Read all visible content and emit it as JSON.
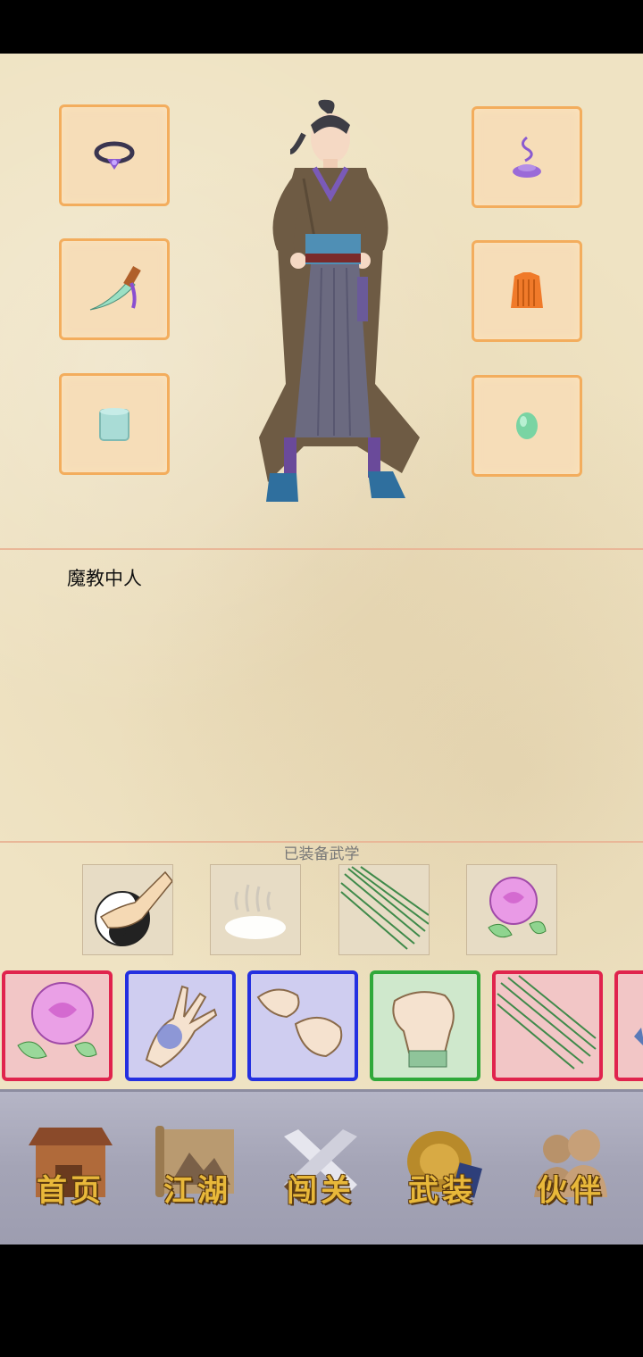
{
  "character": {
    "description": "魔教中人"
  },
  "equipment_slots": [
    {
      "name": "ring-icon"
    },
    {
      "name": "incense-icon"
    },
    {
      "name": "dagger-icon"
    },
    {
      "name": "armor-icon"
    },
    {
      "name": "bracer-icon"
    },
    {
      "name": "jade-icon"
    }
  ],
  "martial_arts": {
    "label": "已装备武学",
    "equipped": [
      {
        "name": "taiji-palm-icon"
      },
      {
        "name": "mist-icon"
      },
      {
        "name": "needles-icon"
      },
      {
        "name": "rose-icon"
      }
    ],
    "available": [
      {
        "name": "rose-card",
        "border": "#e0244d"
      },
      {
        "name": "claw-card",
        "border": "#2430e0"
      },
      {
        "name": "fists-card",
        "border": "#2430e0"
      },
      {
        "name": "fist-card",
        "border": "#2fa83a"
      },
      {
        "name": "needles-card",
        "border": "#e0244d"
      },
      {
        "name": "partial-card",
        "border": "#e0244d"
      }
    ]
  },
  "nav": {
    "home": "首页",
    "jianghu": "江湖",
    "challenge": "闯关",
    "equip": "武装",
    "partner": "伙伴"
  }
}
